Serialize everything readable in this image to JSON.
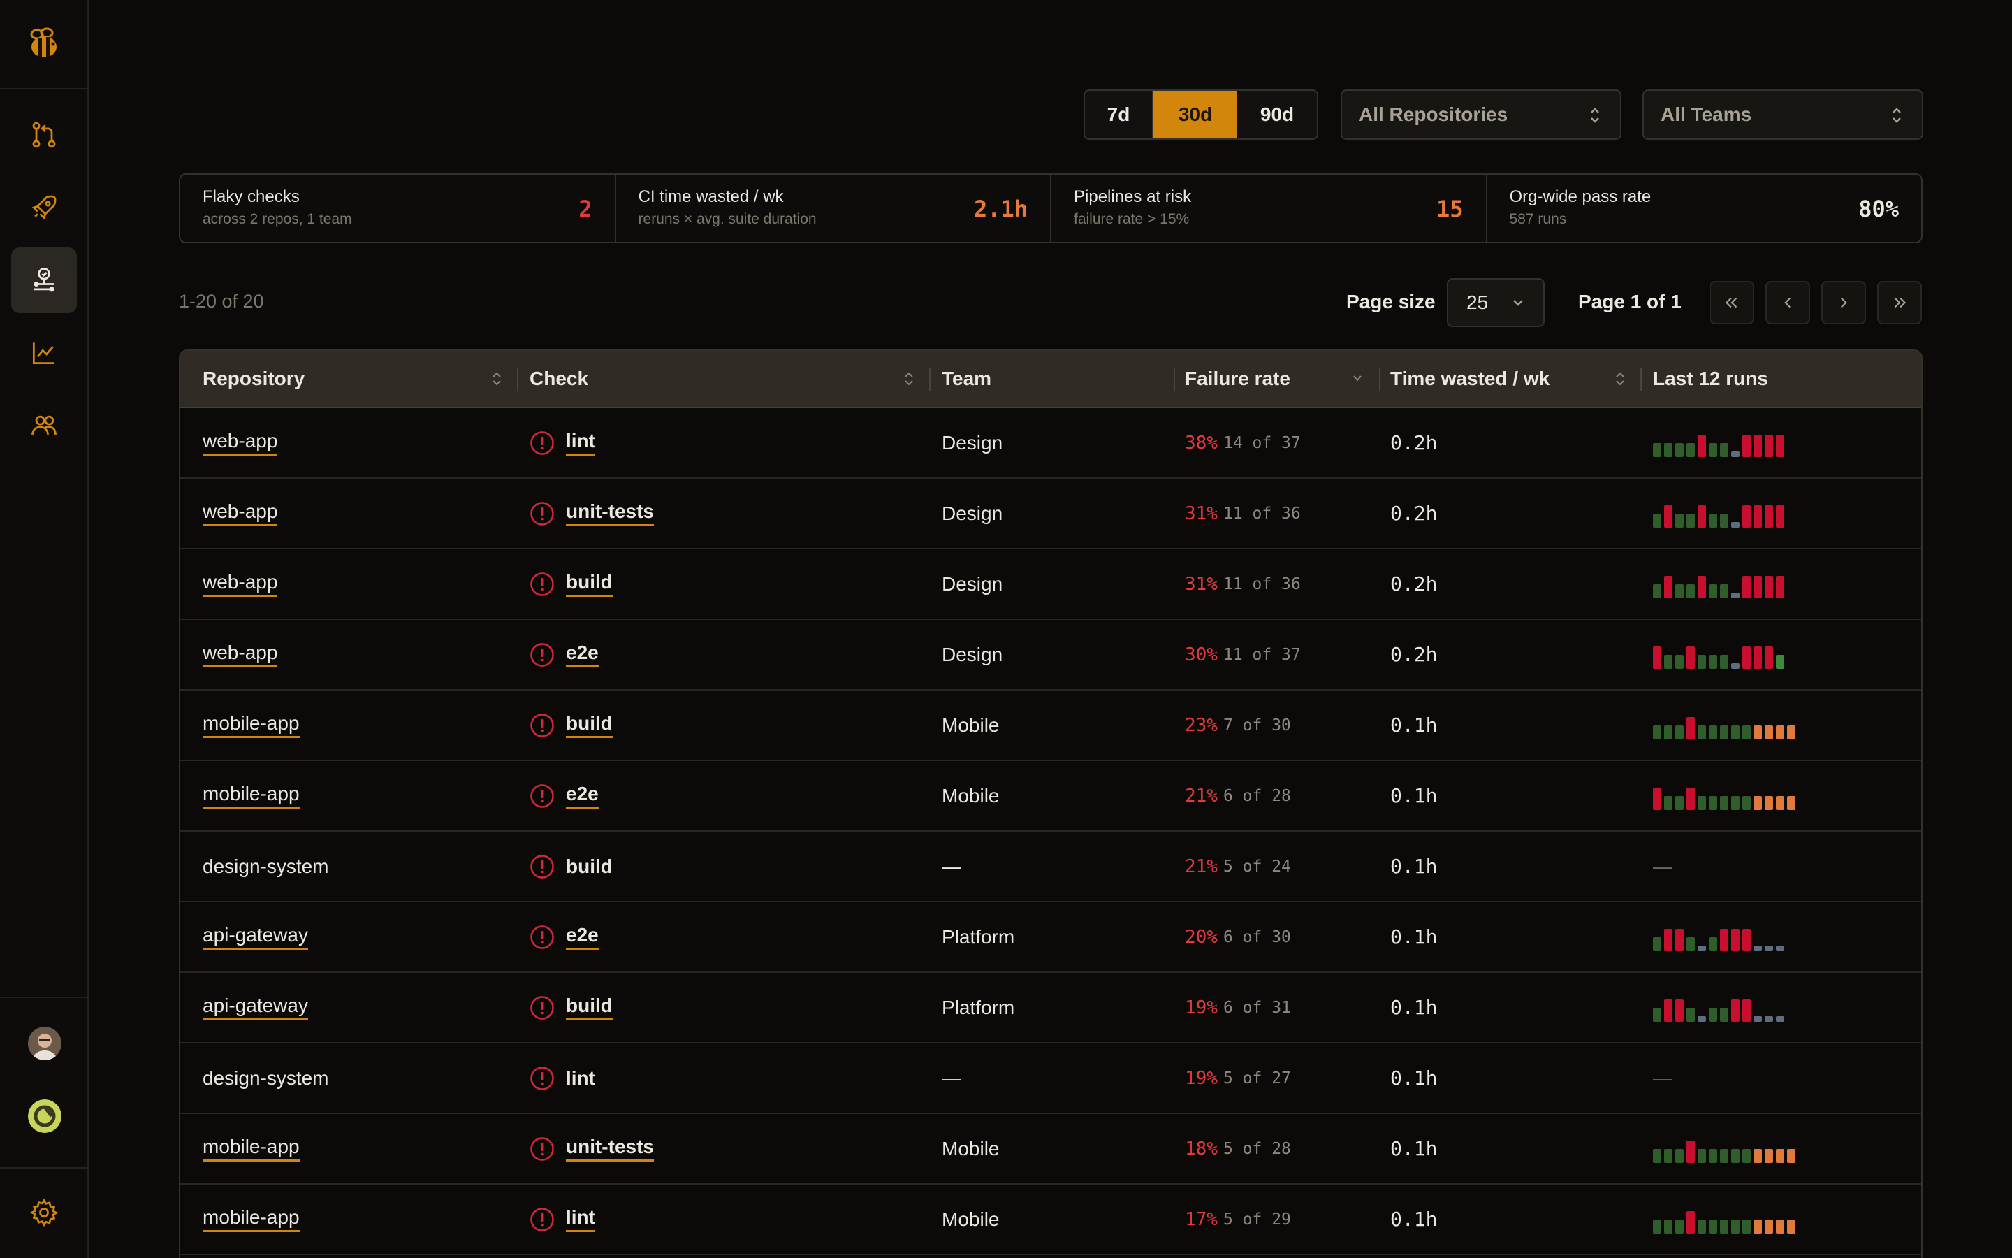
{
  "sidebar": {
    "logo": "bee-logo",
    "nav": [
      {
        "name": "pull-requests-icon",
        "active": false
      },
      {
        "name": "rocket-icon",
        "active": false
      },
      {
        "name": "flaky-checks-icon",
        "active": true
      },
      {
        "name": "chart-line-icon",
        "active": false
      },
      {
        "name": "team-icon",
        "active": false
      }
    ],
    "settings_icon": "gear-icon"
  },
  "filters": {
    "ranges": [
      "7d",
      "30d",
      "90d"
    ],
    "active_range": "30d",
    "repositories": "All Repositories",
    "teams": "All Teams"
  },
  "stats": [
    {
      "title": "Flaky checks",
      "subtitle": "across 2 repos, 1 team",
      "value": "2",
      "color": "#e23a3a"
    },
    {
      "title": "CI time wasted / wk",
      "subtitle": "reruns × avg. suite duration",
      "value": "2.1h",
      "color": "#e67a3a"
    },
    {
      "title": "Pipelines at risk",
      "subtitle": "failure rate > 15%",
      "value": "15",
      "color": "#e67a3a"
    },
    {
      "title": "Org-wide pass rate",
      "subtitle": "587 runs",
      "value": "80%",
      "color": "#ece7df"
    }
  ],
  "pagination": {
    "range": "1-20 of 20",
    "page_size_label": "Page size",
    "page_size": "25",
    "page_of": "Page 1 of 1"
  },
  "table": {
    "headers": {
      "repository": "Repository",
      "check": "Check",
      "team": "Team",
      "failure_rate": "Failure rate",
      "time_wasted": "Time wasted / wk",
      "last_runs": "Last 12 runs"
    },
    "rows": [
      {
        "repo": "web-app",
        "repo_link": true,
        "check": "lint",
        "check_link": true,
        "team": "Design",
        "rate": "38%",
        "of": "14 of 37",
        "wasted": "0.2h",
        "runs": "ggggrggbrrrr"
      },
      {
        "repo": "web-app",
        "repo_link": true,
        "check": "unit-tests",
        "check_link": true,
        "team": "Design",
        "rate": "31%",
        "of": "11 of 36",
        "wasted": "0.2h",
        "runs": "grggrggbrrrr"
      },
      {
        "repo": "web-app",
        "repo_link": true,
        "check": "build",
        "check_link": true,
        "team": "Design",
        "rate": "31%",
        "of": "11 of 36",
        "wasted": "0.2h",
        "runs": "grggrggbrrrr"
      },
      {
        "repo": "web-app",
        "repo_link": true,
        "check": "e2e",
        "check_link": true,
        "team": "Design",
        "rate": "30%",
        "of": "11 of 37",
        "wasted": "0.2h",
        "runs": "rggrgggbrrrG"
      },
      {
        "repo": "mobile-app",
        "repo_link": true,
        "check": "build",
        "check_link": true,
        "team": "Mobile",
        "rate": "23%",
        "of": "7 of 30",
        "wasted": "0.1h",
        "runs": "gggrgggggoooo"
      },
      {
        "repo": "mobile-app",
        "repo_link": true,
        "check": "e2e",
        "check_link": true,
        "team": "Mobile",
        "rate": "21%",
        "of": "6 of 28",
        "wasted": "0.1h",
        "runs": "rggrgggggoooo"
      },
      {
        "repo": "design-system",
        "repo_link": false,
        "check": "build",
        "check_link": false,
        "team": "—",
        "rate": "21%",
        "of": "5 of 24",
        "wasted": "0.1h",
        "runs": ""
      },
      {
        "repo": "api-gateway",
        "repo_link": true,
        "check": "e2e",
        "check_link": true,
        "team": "Platform",
        "rate": "20%",
        "of": "6 of 30",
        "wasted": "0.1h",
        "runs": "grrgbgrrrbbb"
      },
      {
        "repo": "api-gateway",
        "repo_link": true,
        "check": "build",
        "check_link": true,
        "team": "Platform",
        "rate": "19%",
        "of": "6 of 31",
        "wasted": "0.1h",
        "runs": "grrgbggrrbbb"
      },
      {
        "repo": "design-system",
        "repo_link": false,
        "check": "lint",
        "check_link": false,
        "team": "—",
        "rate": "19%",
        "of": "5 of 27",
        "wasted": "0.1h",
        "runs": ""
      },
      {
        "repo": "mobile-app",
        "repo_link": true,
        "check": "unit-tests",
        "check_link": true,
        "team": "Mobile",
        "rate": "18%",
        "of": "5 of 28",
        "wasted": "0.1h",
        "runs": "gggrgggggoooo"
      },
      {
        "repo": "mobile-app",
        "repo_link": true,
        "check": "lint",
        "check_link": true,
        "team": "Mobile",
        "rate": "17%",
        "of": "5 of 29",
        "wasted": "0.1h",
        "runs": "gggrgggggoooo"
      }
    ],
    "run_colors": {
      "g": "#2f5e2b",
      "G": "#3c8a3a",
      "r": "#c8102e",
      "b": "#5e6e80",
      "o": "#e07a3a"
    }
  }
}
